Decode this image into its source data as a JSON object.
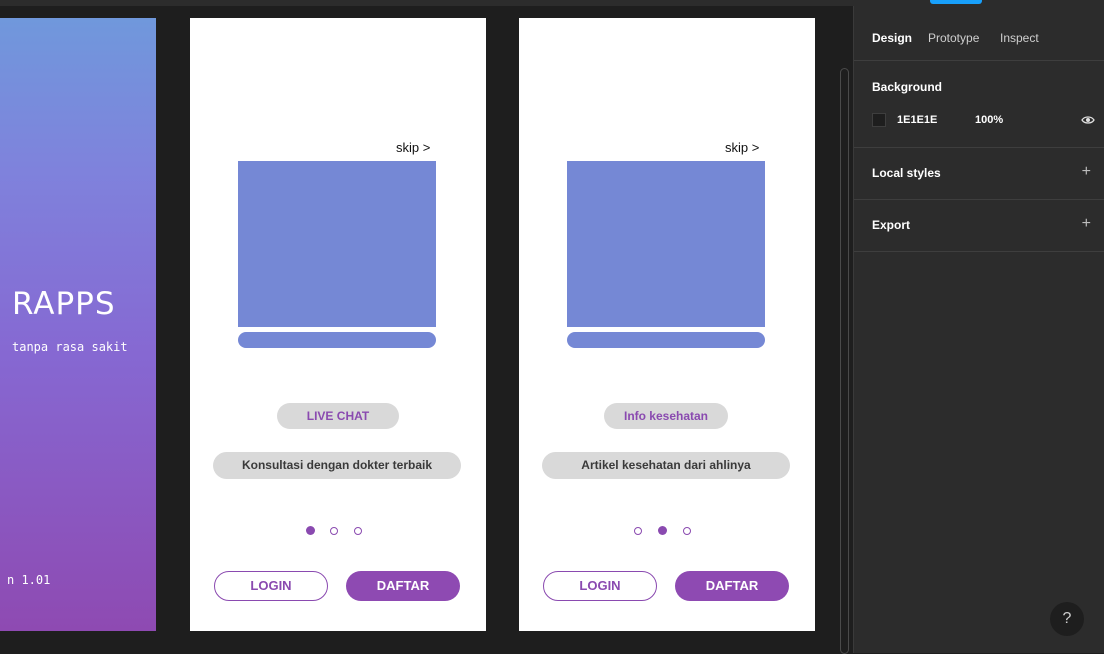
{
  "splash": {
    "title": "RAPPS",
    "tagline": "tanpa rasa sakit",
    "version": "n 1.01"
  },
  "screens": [
    {
      "skip": "skip >",
      "heading": "LIVE CHAT",
      "subtitle": "Konsultasi dengan dokter terbaik",
      "active_dot": 1,
      "login_label": "LOGIN",
      "daftar_label": "DAFTAR"
    },
    {
      "skip": "skip >",
      "heading": "Info kesehatan",
      "subtitle": "Artikel kesehatan dari ahlinya",
      "active_dot": 2,
      "login_label": "LOGIN",
      "daftar_label": "DAFTAR"
    }
  ],
  "panel": {
    "tabs": [
      "Design",
      "Prototype",
      "Inspect"
    ],
    "active_tab": "Design",
    "background": {
      "title": "Background",
      "hex": "1E1E1E",
      "opacity": "100%",
      "visibility_icon": "eye-icon"
    },
    "local_styles": "Local styles",
    "export": "Export",
    "plus_icon": "+",
    "help": "?"
  },
  "colors": {
    "canvas": "#1e1e1e",
    "panel": "#2c2c2c",
    "accent_purple": "#8e4ab2",
    "placeholder_blue": "#7588d5",
    "pill_gray": "#d9d9d9"
  }
}
